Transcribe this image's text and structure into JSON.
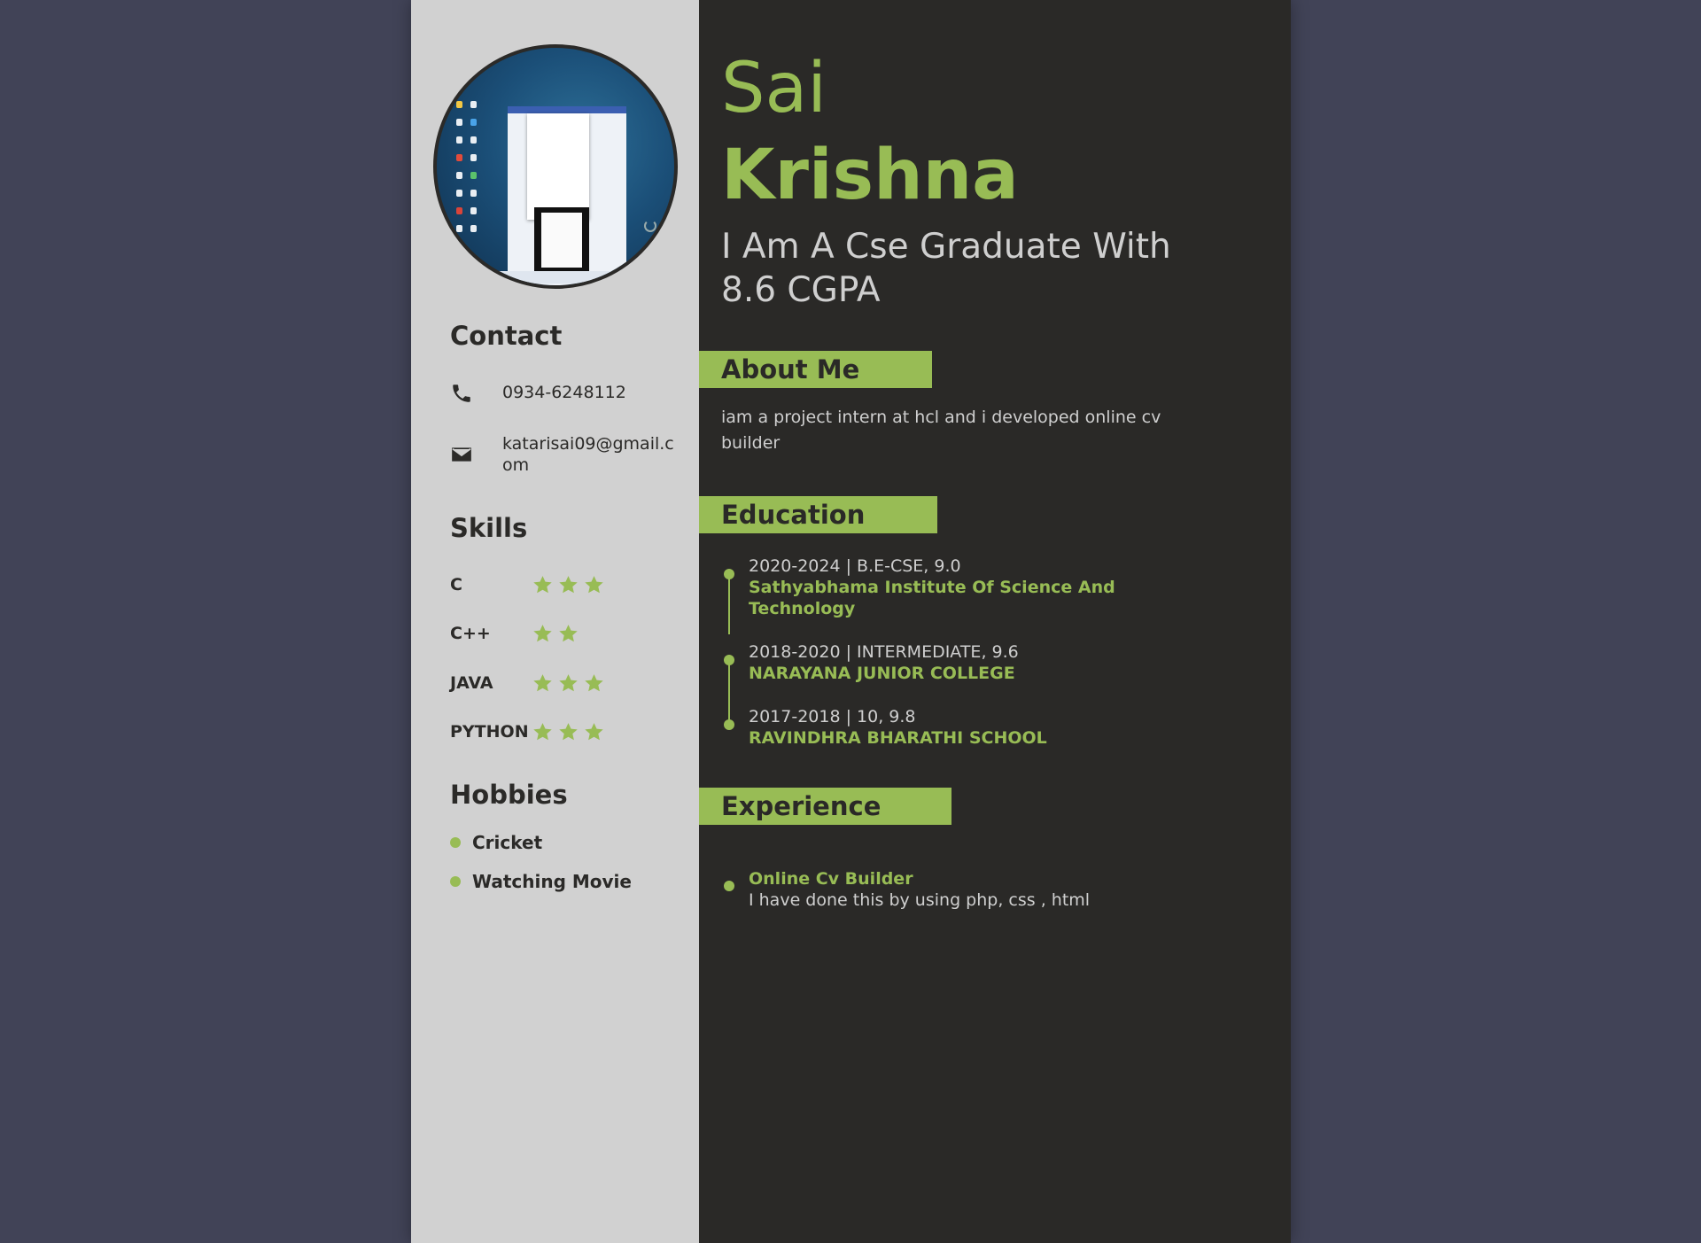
{
  "profile": {
    "first_name": "Sai",
    "last_name": "Krishna",
    "tagline": "I Am A Cse Graduate With 8.6 CGPA"
  },
  "sidebar": {
    "contact_heading": "Contact",
    "phone": "0934-6248112",
    "email": "katarisai09@gmail.com",
    "skills_heading": "Skills",
    "skills": [
      {
        "name": "C",
        "stars": 3
      },
      {
        "name": "C++",
        "stars": 2
      },
      {
        "name": "JAVA",
        "stars": 3
      },
      {
        "name": "PYTHON",
        "stars": 3
      }
    ],
    "hobbies_heading": "Hobbies",
    "hobbies": [
      "Cricket",
      "Watching Movie"
    ]
  },
  "about": {
    "heading": "About Me",
    "text": "iam a project intern at hcl and i developed online cv builder"
  },
  "education": {
    "heading": "Education",
    "items": [
      {
        "meta": "2020-2024 | B.E-CSE, 9.0",
        "school": "Sathyabhama Institute Of Science And Technology"
      },
      {
        "meta": "2018-2020 | INTERMEDIATE, 9.6",
        "school": "NARAYANA JUNIOR COLLEGE"
      },
      {
        "meta": "2017-2018 | 10, 9.8",
        "school": "RAVINDHRA BHARATHI SCHOOL"
      }
    ]
  },
  "experience": {
    "heading": "Experience",
    "items": [
      {
        "title": "Online Cv Builder",
        "desc": "I have done this by using php, css , html"
      }
    ]
  },
  "colors": {
    "accent": "#98bc55",
    "sidebar_bg": "#d1d1d1",
    "main_bg": "#2a2927",
    "page_bg": "#414357"
  },
  "icons": {
    "phone": "phone-icon",
    "email": "envelope-icon",
    "skill_rating": "star-icon"
  }
}
